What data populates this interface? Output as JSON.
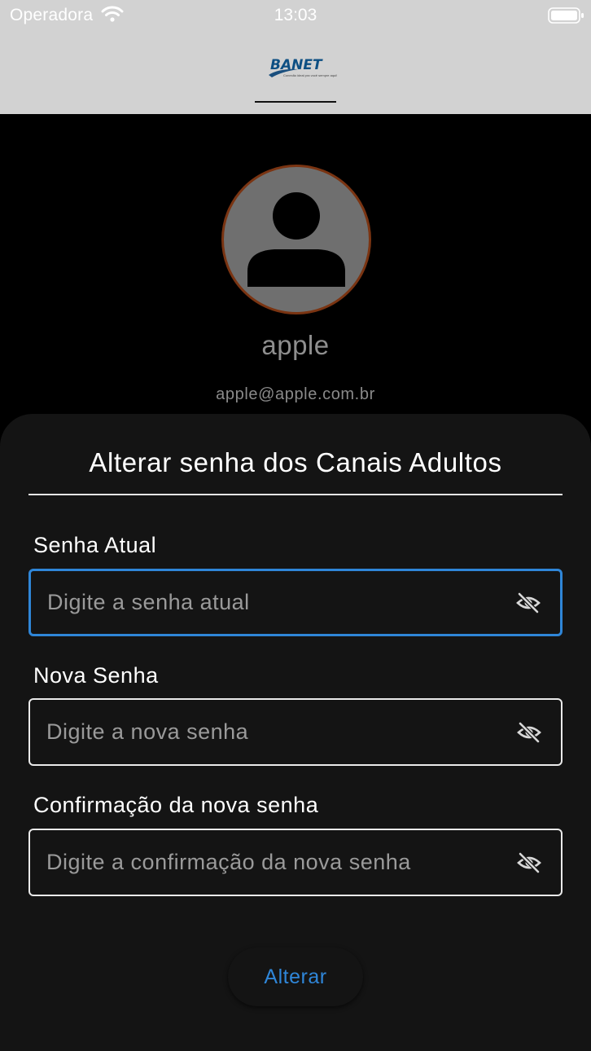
{
  "status_bar": {
    "carrier": "Operadora",
    "time": "13:03"
  },
  "header": {
    "logo_text": "BANET",
    "logo_tagline": "Conexão ideal pra você sempre aqui!",
    "brand_color": "#0d4f83"
  },
  "profile": {
    "name": "apple",
    "email": "apple@apple.com.br",
    "avatar_border_color": "#7a3412"
  },
  "sheet": {
    "title": "Alterar senha dos Canais Adultos",
    "fields": [
      {
        "label": "Senha Atual",
        "placeholder": "Digite a senha atual",
        "value": "",
        "focused": true
      },
      {
        "label": "Nova Senha",
        "placeholder": "Digite a nova senha",
        "value": "",
        "focused": false
      },
      {
        "label": "Confirmação da nova senha",
        "placeholder": "Digite a confirmação da nova senha",
        "value": "",
        "focused": false
      }
    ],
    "submit_label": "Alterar"
  },
  "colors": {
    "accent": "#2f86d8",
    "sheet_background": "#141414",
    "header_background": "#d2d2d2"
  },
  "icons": {
    "password_toggle": "eye-off-icon"
  }
}
